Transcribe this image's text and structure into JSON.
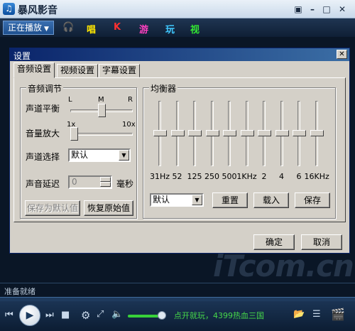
{
  "app": {
    "title": "暴风影音",
    "logo_glyph": "♫",
    "window_buttons": [
      "▣",
      "–",
      "□",
      "✕"
    ]
  },
  "menu": {
    "now_playing": "正在播放",
    "dropdown_glyph": "▼",
    "headphone_icon": "headphone-icon",
    "links": [
      {
        "label": "唱",
        "color": "#ffe600"
      },
      {
        "label": "K",
        "color": "#ff3030"
      },
      {
        "label": "游",
        "color": "#ff40c0"
      },
      {
        "label": "玩",
        "color": "#40c8ff"
      },
      {
        "label": "视",
        "color": "#33e633"
      }
    ]
  },
  "dialog": {
    "title": "设置",
    "close_glyph": "✕",
    "tabs": [
      "音频设置",
      "视频设置",
      "字幕设置"
    ],
    "audio": {
      "group_title": "音频调节",
      "balance_label": "声道平衡",
      "balance_marks": [
        "L",
        "M",
        "R"
      ],
      "balance_value": 0.5,
      "amplify_label": "音量放大",
      "amplify_marks": [
        "1x",
        "10x"
      ],
      "amplify_value": 0.0,
      "channel_label": "声道选择",
      "channel_value": "默认",
      "delay_label": "声音延迟",
      "delay_value": "0",
      "delay_unit": "毫秒",
      "save_default_button": "保存为默认值",
      "restore_button": "恢复原始值"
    },
    "equalizer": {
      "group_title": "均衡器",
      "bands": [
        "31Hz",
        "52",
        "125",
        "250",
        "500",
        "1KHz",
        "2",
        "4",
        "6",
        "16KHz"
      ],
      "levels": [
        0.5,
        0.5,
        0.5,
        0.5,
        0.5,
        0.5,
        0.5,
        0.5,
        0.5,
        0.5
      ],
      "preset_value": "默认",
      "reset_button": "重置",
      "load_button": "载入",
      "save_button": "保存"
    },
    "ok_button": "确定",
    "cancel_button": "取消"
  },
  "watermark": "iTcom.cn",
  "status": {
    "text": "准备就绪"
  },
  "controls": {
    "prev_glyph": "⏮",
    "play_glyph": "▶",
    "next_glyph": "⏭",
    "stop_glyph": "■",
    "settings_glyph": "⚙",
    "fullscreen_glyph": "⤢",
    "volume_glyph": "🔈",
    "volume_level": 0.85,
    "promo": "点开就玩，4399热血三国",
    "folder_glyph": "📂",
    "playlist_glyph": "☰",
    "box_glyph": "🎬"
  }
}
